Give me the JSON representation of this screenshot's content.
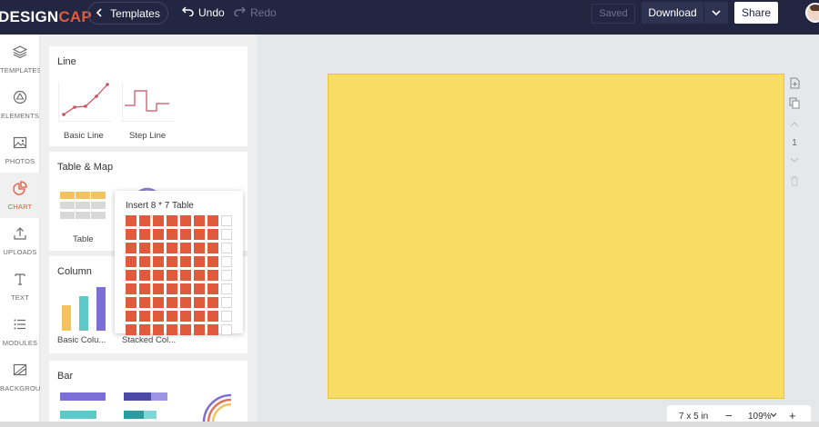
{
  "header": {
    "logo_main": "DESIGN",
    "logo_accent": "CAP",
    "templates_label": "Templates",
    "undo_label": "Undo",
    "redo_label": "Redo",
    "saved_label": "Saved",
    "download_label": "Download",
    "share_label": "Share"
  },
  "rail": {
    "items": [
      {
        "label": "TEMPLATES",
        "icon": "layers-icon"
      },
      {
        "label": "ELEMENTS",
        "icon": "elements-icon"
      },
      {
        "label": "PHOTOS",
        "icon": "image-icon"
      },
      {
        "label": "CHART",
        "icon": "pie-chart-icon",
        "active": true
      },
      {
        "label": "UPLOADS",
        "icon": "upload-icon"
      },
      {
        "label": "TEXT",
        "icon": "text-icon"
      },
      {
        "label": "MODULES",
        "icon": "list-icon"
      },
      {
        "label": "BACKGROUND",
        "icon": "background-icon"
      }
    ]
  },
  "panel": {
    "sections": {
      "line": {
        "title": "Line",
        "items": [
          "Basic Line",
          "Step Line"
        ]
      },
      "table_map": {
        "title": "Table & Map",
        "items": [
          "Table"
        ]
      },
      "column": {
        "title": "Column",
        "items": [
          "Basic Colu...",
          "Stacked Col..."
        ]
      },
      "bar": {
        "title": "Bar"
      }
    }
  },
  "popover": {
    "title": "Insert 8 * 7 Table",
    "columns_total": 8,
    "rows_total": 9,
    "selected_columns": 7,
    "selected_rows": 9
  },
  "canvas": {
    "color": "#fadb63",
    "page_number": "1"
  },
  "zoom": {
    "size_label": "7 x 5 in",
    "minus": "−",
    "level": "109%",
    "plus": "+"
  },
  "colors": {
    "header_bg": "#232641",
    "accent": "#e05a3c"
  }
}
